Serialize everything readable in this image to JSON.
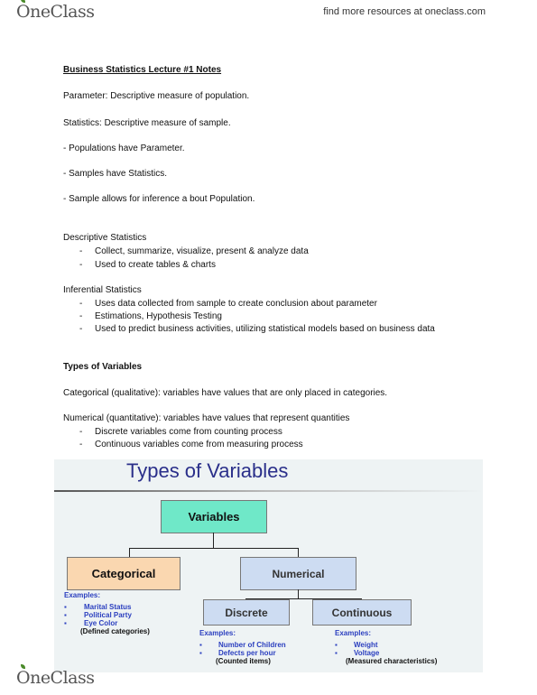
{
  "header": {
    "logo": "OneClass",
    "link": "find more resources at oneclass.com"
  },
  "doc": {
    "title": "Business Statistics Lecture #1 Notes",
    "lines": [
      "Parameter: Descriptive measure of population.",
      "Statistics: Descriptive measure of sample.",
      "- Populations have Parameter.",
      "- Samples have Statistics.",
      "- Sample allows for inference a bout Population."
    ],
    "descriptive": {
      "heading": "Descriptive Statistics",
      "items": [
        "Collect, summarize, visualize, present & analyze data",
        "Used to create tables & charts"
      ]
    },
    "inferential": {
      "heading": "Inferential Statistics",
      "items": [
        "Uses data collected from sample to create conclusion about parameter",
        "Estimations, Hypothesis Testing",
        "Used to predict business activities, utilizing statistical models based on business data"
      ]
    },
    "types_heading": "Types of Variables",
    "categorical": "Categorical (qualitative): variables have values that are only placed in categories.",
    "numerical": {
      "text": "Numerical (quantitative): variables have values that represent quantities",
      "items": [
        "Discrete variables come from counting process",
        "Continuous variables come from measuring process"
      ]
    },
    "bullet": "-"
  },
  "figure": {
    "title": "Types of Variables",
    "root": "Variables",
    "categorical": "Categorical",
    "numerical": "Numerical",
    "discrete": "Discrete",
    "continuous": "Continuous",
    "examples_label": "Examples:",
    "bullet": "▪",
    "cat_examples": [
      "Marital Status",
      "Political Party",
      "Eye Color"
    ],
    "cat_note": "(Defined categories)",
    "disc_examples": [
      "Number of Children",
      "Defects per hour"
    ],
    "disc_note": "(Counted items)",
    "cont_examples": [
      "Weight",
      "Voltage"
    ],
    "cont_note": "(Measured characteristics)",
    "colors": {
      "root": "#6fe8c8",
      "categorical": "#fad7b0",
      "numerical": "#cddcf2",
      "title": "#2a2f8a",
      "examples": "#2b3fbf"
    }
  },
  "footer": {
    "logo": "OneClass"
  }
}
